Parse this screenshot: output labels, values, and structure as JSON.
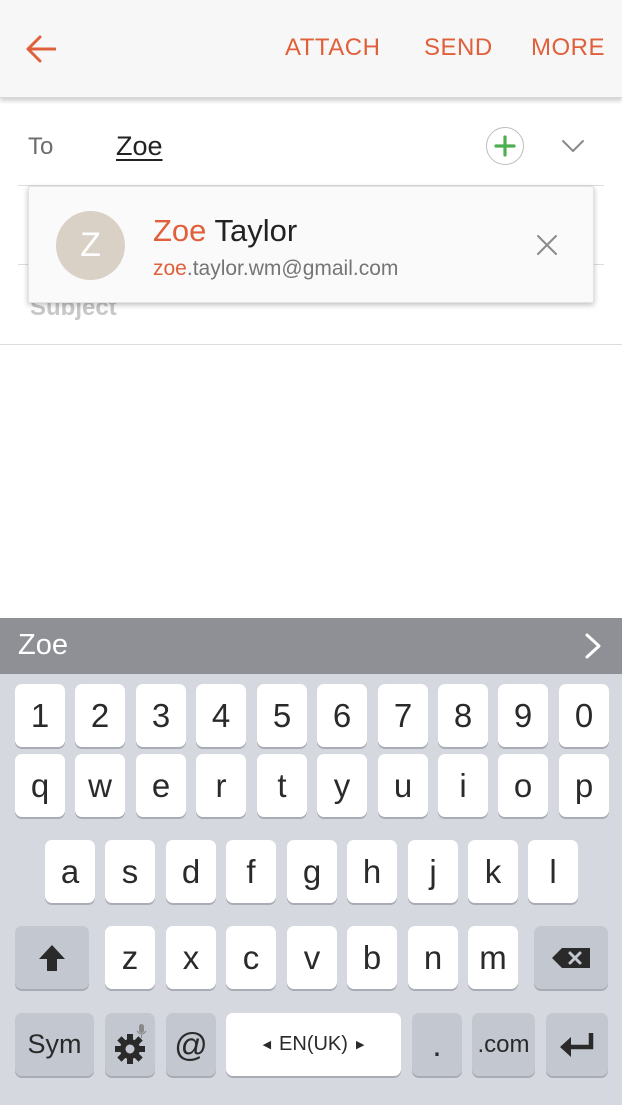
{
  "appbar": {
    "back_icon": "arrow-left-icon",
    "actions": [
      "ATTACH",
      "SEND",
      "MORE"
    ]
  },
  "compose": {
    "to_label": "To",
    "to_value": "Zoe",
    "add_icon": "plus-circle-icon",
    "expand_icon": "chevron-down-icon",
    "subject_label": "Subject"
  },
  "suggestion": {
    "avatar_letter": "Z",
    "name_match": "Zoe",
    "name_rest": " Taylor",
    "email_match": "zoe",
    "email_rest": ".taylor.wm@gmail.com",
    "close_icon": "close-icon"
  },
  "prediction": {
    "word": "Zoe",
    "more_icon": "chevron-right-icon"
  },
  "keyboard": {
    "row_numbers": [
      "1",
      "2",
      "3",
      "4",
      "5",
      "6",
      "7",
      "8",
      "9",
      "0"
    ],
    "row_1": [
      "q",
      "w",
      "e",
      "r",
      "t",
      "y",
      "u",
      "i",
      "o",
      "p"
    ],
    "row_2": [
      "a",
      "s",
      "d",
      "f",
      "g",
      "h",
      "j",
      "k",
      "l"
    ],
    "row_3": [
      "z",
      "x",
      "c",
      "v",
      "b",
      "n",
      "m"
    ],
    "sym_label": "Sym",
    "at_label": "@",
    "space_label": "EN(UK)",
    "period_label": ".",
    "com_label": ".com",
    "shift_icon": "shift-arrow-icon",
    "backspace_icon": "backspace-icon",
    "settings_icon": "gear-mic-icon",
    "enter_icon": "enter-icon"
  },
  "colors": {
    "accent": "#e0603c",
    "add_green": "#4caf50",
    "prediction_bar": "#8f9096",
    "keyboard_bg": "#d5d8df"
  }
}
